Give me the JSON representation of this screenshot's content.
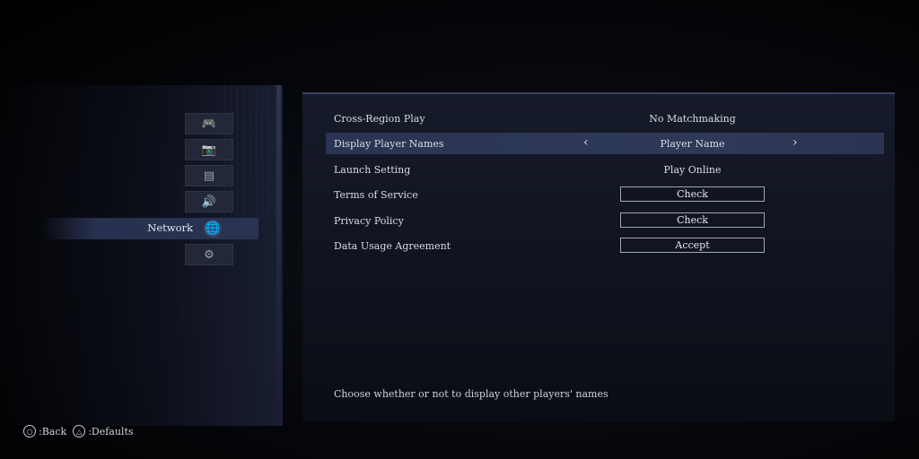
{
  "sidebar": {
    "categories": [
      {
        "icon": "gamepad-icon",
        "glyph": "🎮"
      },
      {
        "icon": "camera-icon",
        "glyph": "📷"
      },
      {
        "icon": "display-icon",
        "glyph": "▤"
      },
      {
        "icon": "speaker-icon",
        "glyph": "🔊"
      },
      {
        "icon": "globe-icon",
        "glyph": "🌐",
        "label": "Network",
        "active": true
      },
      {
        "icon": "system-icon",
        "glyph": "⚙"
      }
    ]
  },
  "settings": {
    "rows": [
      {
        "name": "Cross-Region Play",
        "value": "No Matchmaking"
      },
      {
        "name": "Display Player Names",
        "value": "Player Name",
        "selected": true
      },
      {
        "name": "Launch Setting",
        "value": "Play Online"
      },
      {
        "name": "Terms of Service",
        "button": "Check"
      },
      {
        "name": "Privacy Policy",
        "button": "Check"
      },
      {
        "name": "Data Usage Agreement",
        "button": "Accept"
      }
    ],
    "arrow_left": "‹",
    "arrow_right": "›"
  },
  "description": "Choose whether or not to display other players' names",
  "footer": {
    "back_button": "○",
    "back_label": ":Back",
    "defaults_button": "△",
    "defaults_label": ":Defaults"
  }
}
